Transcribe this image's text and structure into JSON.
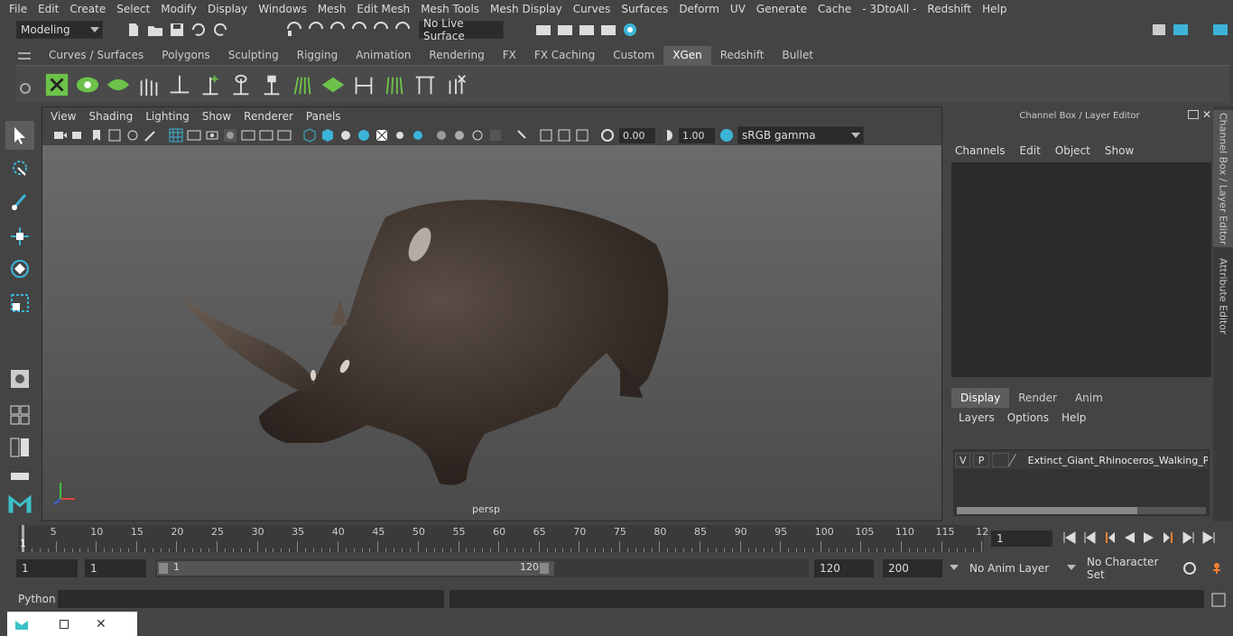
{
  "menubar": [
    "File",
    "Edit",
    "Create",
    "Select",
    "Modify",
    "Display",
    "Windows",
    "Mesh",
    "Edit Mesh",
    "Mesh Tools",
    "Mesh Display",
    "Curves",
    "Surfaces",
    "Deform",
    "UV",
    "Generate",
    "Cache",
    "- 3DtoAll -",
    "Redshift",
    "Help"
  ],
  "toolbar": {
    "mode": "Modeling",
    "live_surface": "No Live Surface"
  },
  "shelf_tabs": [
    {
      "label": "Curves / Surfaces",
      "active": false
    },
    {
      "label": "Polygons",
      "active": false
    },
    {
      "label": "Sculpting",
      "active": false
    },
    {
      "label": "Rigging",
      "active": false
    },
    {
      "label": "Animation",
      "active": false
    },
    {
      "label": "Rendering",
      "active": false
    },
    {
      "label": "FX",
      "active": false
    },
    {
      "label": "FX Caching",
      "active": false
    },
    {
      "label": "Custom",
      "active": false
    },
    {
      "label": "XGen",
      "active": true
    },
    {
      "label": "Redshift",
      "active": false
    },
    {
      "label": "Bullet",
      "active": false
    }
  ],
  "viewport": {
    "menu": [
      "View",
      "Shading",
      "Lighting",
      "Show",
      "Renderer",
      "Panels"
    ],
    "exposure": "0.00",
    "gamma": "1.00",
    "color_space": "sRGB gamma",
    "camera": "persp"
  },
  "channel_box": {
    "title": "Channel Box / Layer Editor",
    "menu": [
      "Channels",
      "Edit",
      "Object",
      "Show"
    ]
  },
  "layer_editor": {
    "tabs": [
      {
        "label": "Display",
        "active": true
      },
      {
        "label": "Render",
        "active": false
      },
      {
        "label": "Anim",
        "active": false
      }
    ],
    "menu": [
      "Layers",
      "Options",
      "Help"
    ],
    "layer": {
      "v": "V",
      "p": "P",
      "name": "Extinct_Giant_Rhinoceros_Walking_Po"
    }
  },
  "side_tabs": [
    "Channel Box / Layer Editor",
    "Attribute Editor"
  ],
  "timeline": {
    "ticks": [
      5,
      10,
      15,
      20,
      25,
      30,
      35,
      40,
      45,
      50,
      55,
      60,
      65,
      70,
      75,
      80,
      85,
      90,
      95,
      100,
      105,
      110,
      115,
      "12"
    ],
    "start_label": "1",
    "current_frame": "1"
  },
  "range": {
    "start": "1",
    "playback_start": "1",
    "slider_start": "1",
    "slider_end": "120",
    "playback_end": "120",
    "end": "200",
    "anim_layer": "No Anim Layer",
    "char_set": "No Character Set"
  },
  "command": {
    "label": "Python"
  },
  "colors": {
    "accent": "#5d5d5d",
    "rhino": "#3a302a",
    "xgen_green": "#6cc24a"
  }
}
